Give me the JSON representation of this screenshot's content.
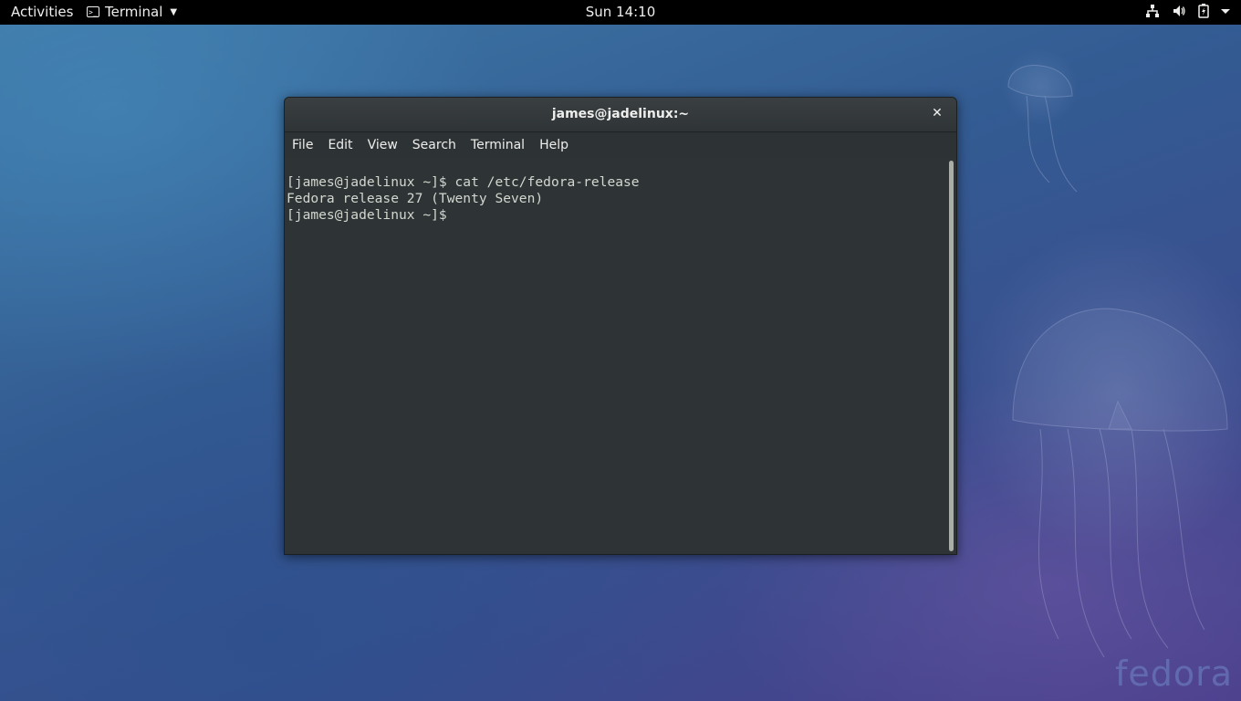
{
  "topbar": {
    "activities": "Activities",
    "app_menu": "Terminal",
    "clock": "Sun 14:10",
    "status_icons": [
      "network-wired-icon",
      "volume-icon",
      "battery-icon",
      "system-menu-arrow-icon"
    ]
  },
  "window": {
    "title": "james@jadelinux:~",
    "close_glyph": "✕",
    "menu": [
      "File",
      "Edit",
      "View",
      "Search",
      "Terminal",
      "Help"
    ]
  },
  "terminal": {
    "lines": [
      "[james@jadelinux ~]$ cat /etc/fedora-release",
      "Fedora release 27 (Twenty Seven)",
      "[james@jadelinux ~]$ "
    ]
  },
  "wallpaper": {
    "logo_text": "fedora"
  },
  "colors": {
    "topbar_bg": "#000000",
    "terminal_bg": "#2e3436",
    "terminal_fg": "#d3d7cf"
  }
}
